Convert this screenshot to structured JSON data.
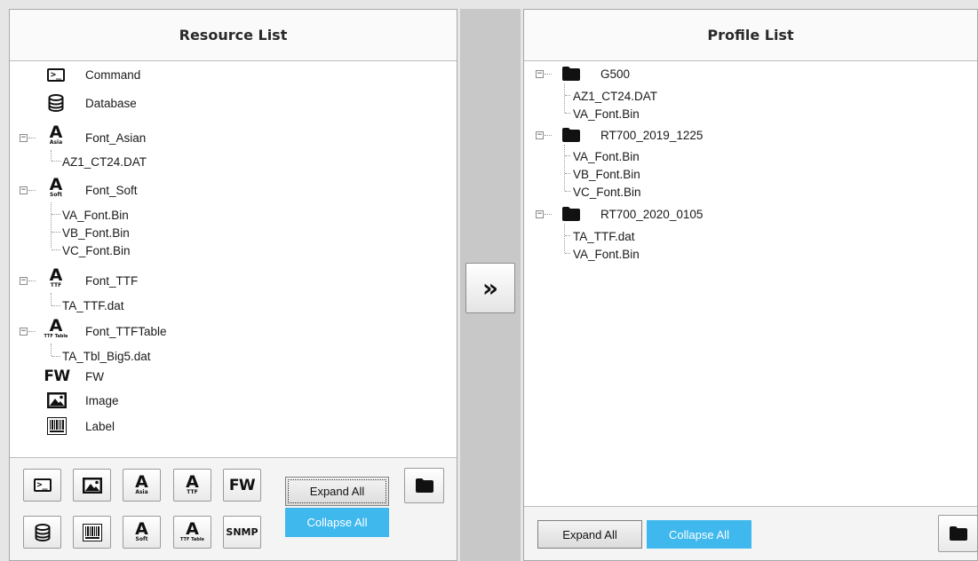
{
  "resource_panel": {
    "title": "Resource List",
    "tree": [
      {
        "label": "Command",
        "icon": "terminal-icon"
      },
      {
        "label": "Database",
        "icon": "database-icon"
      },
      {
        "label": "Font_Asian",
        "icon": "font-asian-icon",
        "icon_sub": "Asia",
        "expanded": true,
        "children": [
          "AZ1_CT24.DAT"
        ]
      },
      {
        "label": "Font_Soft",
        "icon": "font-soft-icon",
        "icon_sub": "Soft",
        "expanded": true,
        "children": [
          "VA_Font.Bin",
          "VB_Font.Bin",
          "VC_Font.Bin"
        ]
      },
      {
        "label": "Font_TTF",
        "icon": "font-ttf-icon",
        "icon_sub": "TTF",
        "expanded": true,
        "children": [
          "TA_TTF.dat"
        ]
      },
      {
        "label": "Font_TTFTable",
        "icon": "font-ttftable-icon",
        "icon_sub": "TTF Table",
        "expanded": true,
        "children": [
          "TA_Tbl_Big5.dat"
        ]
      },
      {
        "label": "FW",
        "icon": "fw-icon",
        "icon_text": "FW"
      },
      {
        "label": "Image",
        "icon": "image-icon"
      },
      {
        "label": "Label",
        "icon": "barcode-icon"
      }
    ],
    "toolbar": {
      "buttons_row1": [
        "terminal-icon",
        "image-icon",
        "font-asian-icon",
        "font-ttf-icon",
        "fw-icon"
      ],
      "buttons_row2": [
        "database-icon",
        "barcode-icon",
        "font-soft-icon",
        "font-ttftable-icon",
        "snmp-icon"
      ],
      "fw_text": "FW",
      "snmp_text": "SNMP",
      "asia_text": "Asia",
      "ttf_text": "TTF",
      "soft_text": "Soft",
      "ttftable_text": "TTF Table",
      "expand_all": "Expand All",
      "collapse_all": "Collapse All"
    }
  },
  "transfer_button": "»",
  "profile_panel": {
    "title": "Profile List",
    "tree": [
      {
        "label": "G500",
        "icon": "folder-icon",
        "expanded": true,
        "children": [
          "AZ1_CT24.DAT",
          "VA_Font.Bin"
        ]
      },
      {
        "label": "RT700_2019_1225",
        "icon": "folder-icon",
        "expanded": true,
        "children": [
          "VA_Font.Bin",
          "VB_Font.Bin",
          "VC_Font.Bin"
        ]
      },
      {
        "label": "RT700_2020_0105",
        "icon": "folder-icon",
        "expanded": true,
        "children": [
          "TA_TTF.dat",
          "VA_Font.Bin"
        ]
      }
    ],
    "toolbar": {
      "expand_all": "Expand All",
      "collapse_all": "Collapse All"
    }
  },
  "colors": {
    "accent": "#3fb8ee",
    "panel_bg": "#ffffff",
    "middle_bg": "#c8c8c8"
  }
}
